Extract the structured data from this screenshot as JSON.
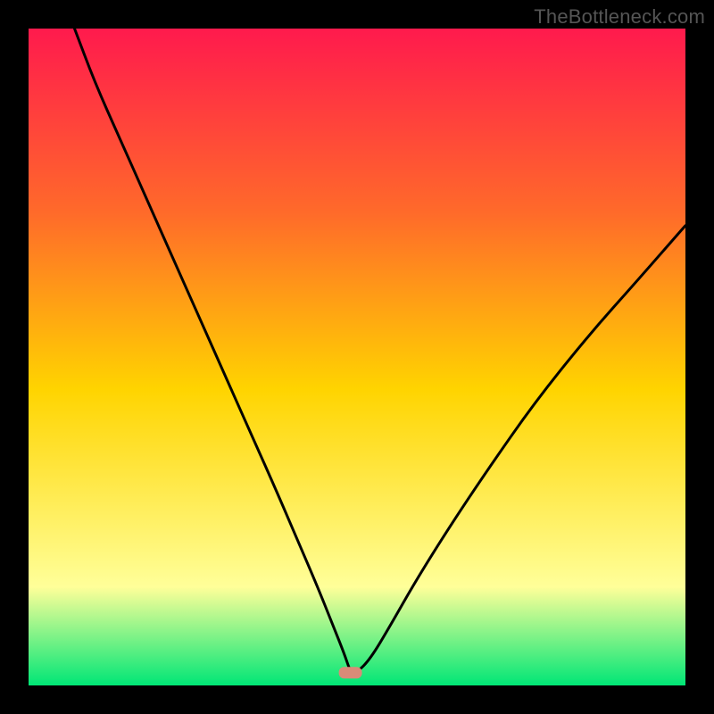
{
  "watermark": "TheBottleneck.com",
  "colors": {
    "black": "#000000",
    "curve": "#000000",
    "grad_top": "#ff1a4d",
    "grad_mid_upper": "#ff6a2a",
    "grad_mid": "#ffd400",
    "grad_lower": "#ffff99",
    "grad_bottom": "#00e676",
    "marker": "#d98b78"
  },
  "chart_data": {
    "type": "line",
    "title": "",
    "xlabel": "",
    "ylabel": "",
    "xlim": [
      0,
      100
    ],
    "ylim": [
      0,
      100
    ],
    "marker": {
      "x": 49,
      "y": 2
    },
    "series": [
      {
        "name": "curve",
        "x": [
          7,
          10,
          14,
          18,
          22,
          26,
          30,
          34,
          38,
          41,
          44,
          46,
          48,
          49,
          50,
          52,
          55,
          59,
          64,
          70,
          77,
          85,
          93,
          100
        ],
        "y": [
          100,
          92,
          83,
          74,
          65,
          56,
          47,
          38,
          29,
          22,
          15,
          10,
          5,
          2,
          2,
          4,
          9,
          16,
          24,
          33,
          43,
          53,
          62,
          70
        ]
      }
    ]
  }
}
